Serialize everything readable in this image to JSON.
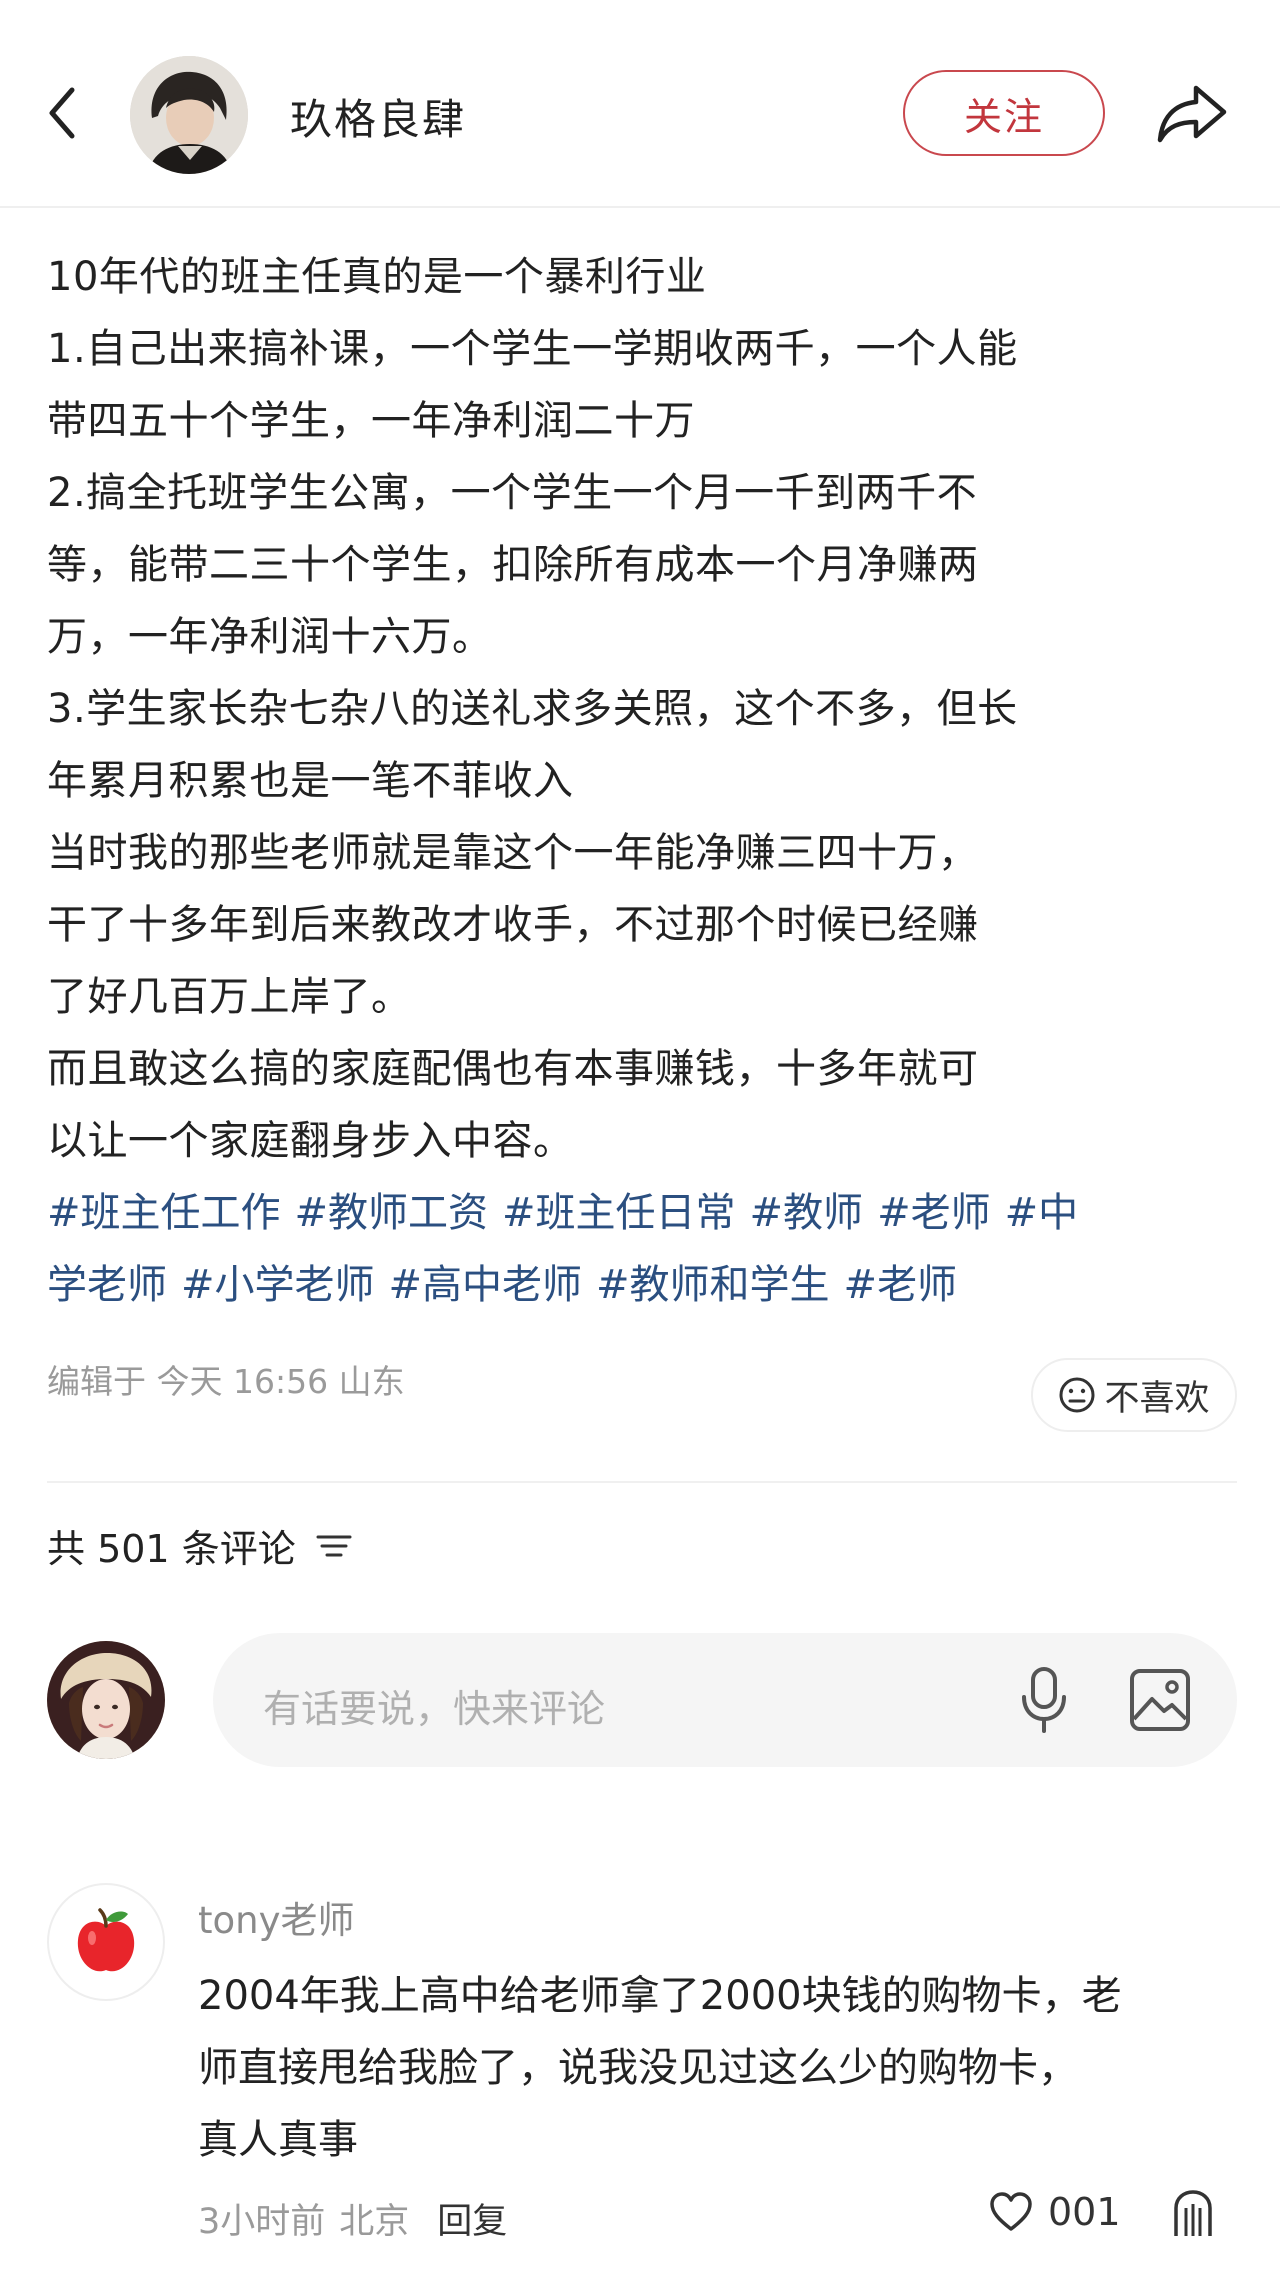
{
  "header": {
    "author_name": "玖格良肆",
    "follow_label": "关注",
    "icons": {
      "back": "back-arrow-icon",
      "share": "share-arrow-icon"
    }
  },
  "post": {
    "lines": [
      "10年代的班主任真的是一个暴利行业",
      "1.自己出来搞补课，一个学生一学期收两千，一个人能",
      "带四五十个学生，一年净利润二十万",
      "2.搞全托班学生公寓，一个学生一个月一千到两千不",
      "等，能带二三十个学生，扣除所有成本一个月净赚两",
      "万，一年净利润十六万。",
      "3.学生家长杂七杂八的送礼求多关照，这个不多，但长",
      "年累月积累也是一笔不菲收入",
      "当时我的那些老师就是靠这个一年能净赚三四十万，",
      "干了十多年到后来教改才收手，不过那个时候已经赚",
      "了好几百万上岸了。",
      "而且敢这么搞的家庭配偶也有本事赚钱，十多年就可",
      "以让一个家庭翻身步入中容。"
    ],
    "hashtag_lines": [
      [
        "#班主任工作",
        "#教师工资",
        "#班主任日常",
        "#教师",
        "#老师",
        "#中"
      ],
      [
        "学老师",
        "#小学老师",
        "#高中老师",
        "#教师和学生",
        "#老师"
      ]
    ],
    "meta": "编辑于 今天 16:56 山东",
    "dislike_label": "不喜欢"
  },
  "comments": {
    "count_label": "共 501 条评论",
    "input_placeholder": "有话要说，快来评论",
    "icons": {
      "sort": "sort-filter-icon",
      "mic": "microphone-icon",
      "image": "image-picker-icon"
    },
    "items": [
      {
        "user": "tony老师",
        "avatar": "apple-avatar",
        "lines": [
          "2004年我上高中给老师拿了2000块钱的购物卡，老",
          "师直接甩给我脸了，说我没见过这么少的购物卡，",
          "真人真事"
        ],
        "time": "3小时前",
        "location": "北京",
        "reply_label": "回复",
        "like_count": "001"
      }
    ]
  },
  "colors": {
    "accent_red": "#c2363d",
    "hashtag_blue": "#2b4f80",
    "muted_gray": "#9a9a9a",
    "input_bg": "#f5f5f5"
  }
}
